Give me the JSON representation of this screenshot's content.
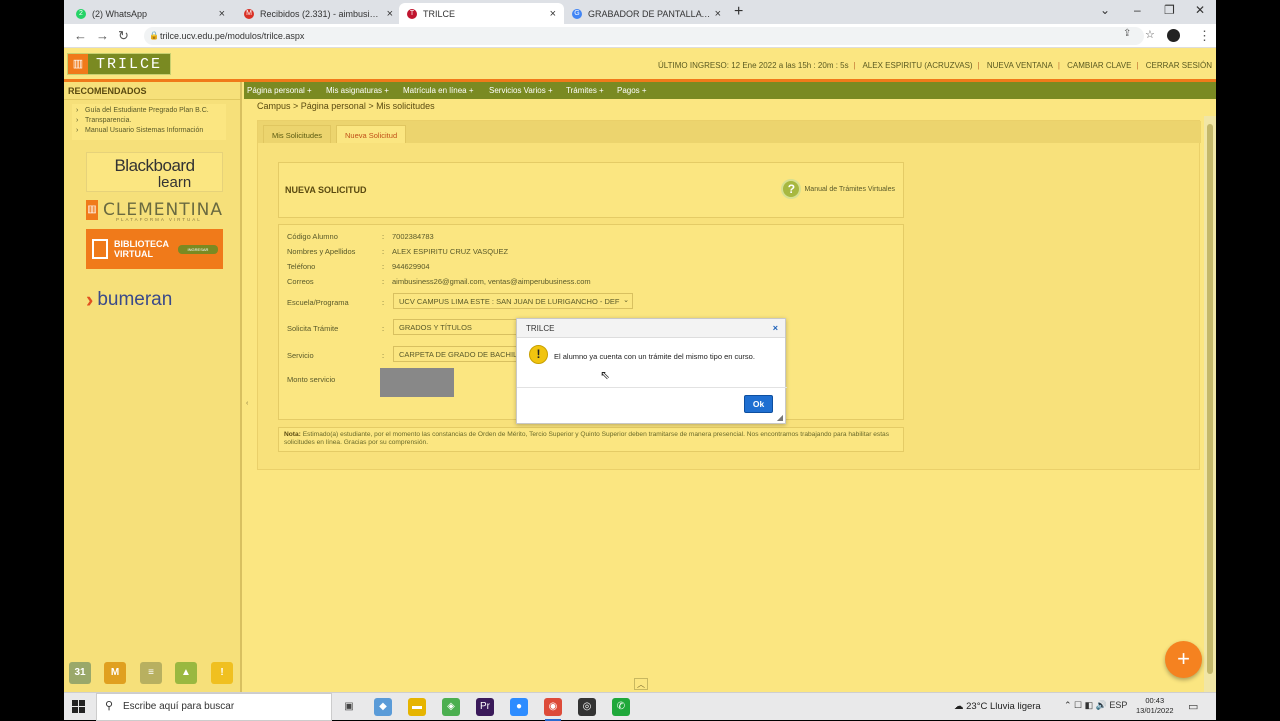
{
  "browser": {
    "tabs": [
      {
        "title": "(2) WhatsApp",
        "fav_color": "#25d366",
        "fav_glyph": "2"
      },
      {
        "title": "Recibidos (2.331) - aimbusiness26@gm...",
        "fav_color": "#d93025",
        "fav_glyph": "M"
      },
      {
        "title": "TRILCE",
        "fav_color": "#c0152f",
        "fav_glyph": "T"
      },
      {
        "title": "GRABADOR DE PANTALLA PARA PC - ...",
        "fav_color": "#4285f4",
        "fav_glyph": "G"
      }
    ],
    "new_tab": "+",
    "url": "trilce.ucv.edu.pe/modulos/trilce.aspx"
  },
  "header": {
    "logo_text": "TRILCE",
    "last_login": "ÚLTIMO INGRESO: 12 Ene 2022 a las 15h : 20m : 5s",
    "user": "ALEX ESPIRITU (ACRUZVAS)",
    "new_window": "NUEVA VENTANA",
    "change_password": "CAMBIAR CLAVE",
    "logout": "CERRAR SESIÓN"
  },
  "sidebar": {
    "title": "RECOMENDADOS",
    "links": [
      "Guía del Estudiante Pregrado Plan B.C.",
      "Transparencia.",
      "Manual Usuario Sistemas Información"
    ],
    "blackboard_1": "Blackboard",
    "blackboard_2": "learn",
    "clementina": "CLEMENTINA",
    "clementina_sub": "PLATAFORMA VIRTUAL",
    "biblioteca_1": "BIBLIOTECA",
    "biblioteca_2": "VIRTUAL",
    "biblioteca_btn": "INGRESAR",
    "bumeran": "bumeran"
  },
  "menu": [
    "Página personal +",
    "Mis asignaturas +",
    "Matrícula en línea +",
    "Servicios Varios +",
    "Trámites +",
    "Pagos +"
  ],
  "breadcrumb": "Campus > Página personal > Mis solicitudes",
  "content": {
    "tabs": [
      "Mis Solicitudes",
      "Nueva Solicitud"
    ],
    "title": "NUEVA SOLICITUD",
    "manual_link": "Manual de Trámites Virtuales",
    "fields": {
      "codigo_label": "Código Alumno",
      "codigo_value": "7002384783",
      "nombres_label": "Nombres y Apellidos",
      "nombres_value": "ALEX ESPIRITU CRUZ VASQUEZ",
      "telefono_label": "Teléfono",
      "telefono_value": "944629904",
      "correos_label": "Correos",
      "correos_value": "aimbusiness26@gmail.com, ventas@aimperubusiness.com",
      "escuela_label": "Escuela/Programa",
      "escuela_value": "UCV CAMPUS LIMA ESTE : SAN JUAN DE LURIGANCHO - DEF",
      "tramite_label": "Solicita Trámite",
      "tramite_value": "GRADOS Y TÍTULOS",
      "servicio_label": "Servicio",
      "servicio_value": "CARPETA DE GRADO DE BACHILLER",
      "monto_label": "Monto servicio"
    },
    "colon": ":",
    "nota_label": "Nota:",
    "nota_text": "Estimado(a) estudiante, por el momento las constancias de Orden de Mérito, Tercio Superior y Quinto Superior deben tramitarse de manera presencial. Nos encontramos trabajando para habilitar estas solicitudes en línea. Gracias por su comprensión."
  },
  "dialog": {
    "title": "TRILCE",
    "close": "×",
    "message": "El alumno ya cuenta con un trámite del mismo tipo en curso.",
    "ok": "Ok"
  },
  "apps": [
    {
      "glyph": "31",
      "color": "#9aa86a"
    },
    {
      "glyph": "M",
      "color": "#e0a020"
    },
    {
      "glyph": "≡",
      "color": "#b8b060"
    },
    {
      "glyph": "▲",
      "color": "#9ab840"
    },
    {
      "glyph": "!",
      "color": "#f0c020"
    }
  ],
  "fab": "+",
  "taskbar": {
    "search_placeholder": "Escribe aquí para buscar",
    "weather": "23°C  Lluvia ligera",
    "lang": "ESP",
    "time": "00:43",
    "date": "13/01/2022",
    "icons": [
      {
        "glyph": "▣",
        "color": "#444"
      },
      {
        "glyph": "◆",
        "color": "#5a9bd8"
      },
      {
        "glyph": "▬",
        "color": "#e6b400"
      },
      {
        "glyph": "◈",
        "color": "#4caf50"
      },
      {
        "glyph": "Pr",
        "color": "#3a1a5a"
      },
      {
        "glyph": "●",
        "color": "#2d8cff"
      },
      {
        "glyph": "◉",
        "color": "#dd4b39"
      },
      {
        "glyph": "◎",
        "color": "#333"
      },
      {
        "glyph": "✆",
        "color": "#1fa83a"
      }
    ]
  }
}
